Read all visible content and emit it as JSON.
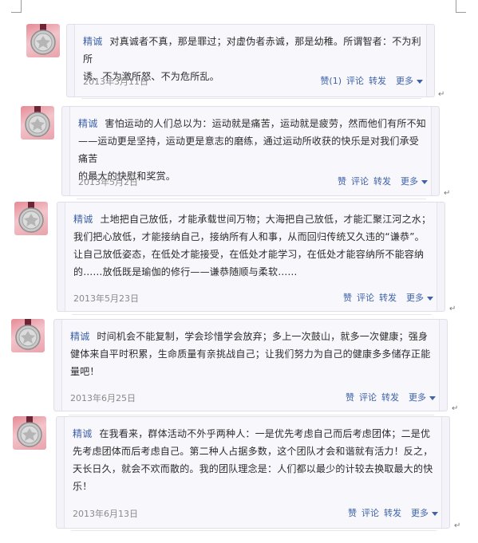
{
  "icons": {
    "avatar": "medal-avatar-icon",
    "more_arrow": "triangle-down-icon",
    "return_mark": "carriage-return-mark"
  },
  "colors": {
    "link": "#3f62a7",
    "text": "#2c2c2c",
    "date": "#8a8a8a",
    "avatar_bg": "#e58a95",
    "bubble_bg": "#f3f3f9"
  },
  "posts": [
    {
      "author": "精诚",
      "lines": [
        "对真诚者不真，那是罪过；对虚伪者赤诚，那是幼稚。所谓智者：不为利所",
        "诱、不为激所怒、不为危所乱。"
      ],
      "date": "2013年3月11日",
      "actions": {
        "like": "赞(1)",
        "comment": "评论",
        "forward": "转发",
        "more": "更多"
      }
    },
    {
      "author": "精诚",
      "lines": [
        "害怕运动的人们总以为：运动就是痛苦，运动就是疲劳，然而他们有所不知",
        "——运动更是坚持，运动更是意志的磨练，通过运动所收获的快乐是对我们承受痛苦",
        "的最大的快慰和奖赏。"
      ],
      "date": "2013年5月2日",
      "actions": {
        "like": "赞",
        "comment": "评论",
        "forward": "转发",
        "more": "更多"
      }
    },
    {
      "author": "精诚",
      "lines": [
        "土地把自己放低，才能承载世间万物；大海把自己放低，才能汇聚江河之水；",
        "我们把心放低，才能接纳自己，接纳所有人和事，从而回归传统又久违的“谦恭”。",
        "让自己放低姿态，在低处才能接受，在低处才能学习，在低处才能容纳所不能容纳",
        "的……放低既是瑜伽的修行——谦恭随顺与柔软……"
      ],
      "date": "2013年5月23日",
      "actions": {
        "like": "赞",
        "comment": "评论",
        "forward": "转发",
        "more": "更多"
      }
    },
    {
      "author": "精诚",
      "lines": [
        "时间机会不能复制，学会珍惜学会放弃；多上一次鼓山，就多一次健康；强身",
        "健体来自平时积累，生命质量有亲挑战自己；让我们努力为自己的健康多多储存正能",
        "量吧！"
      ],
      "date": "2013年6月25日",
      "actions": {
        "like": "赞",
        "comment": "评论",
        "forward": "转发",
        "more": "更多"
      }
    },
    {
      "author": "精诚",
      "lines": [
        "在我看来，群体活动不外乎两种人：一是优先考虑自己而后考虑团体；二是优",
        "先考虑团体而后考虑自己。第二种人占据多数，这个团队才会和谐就有活力！反之，",
        "天长日久，就会不欢而散的。我的团队理念是：人们都以最少的计较去换取最大的快",
        "乐！"
      ],
      "date": "2013年6月13日",
      "actions": {
        "like": "赞",
        "comment": "评论",
        "forward": "转发",
        "more": "更多"
      }
    }
  ]
}
